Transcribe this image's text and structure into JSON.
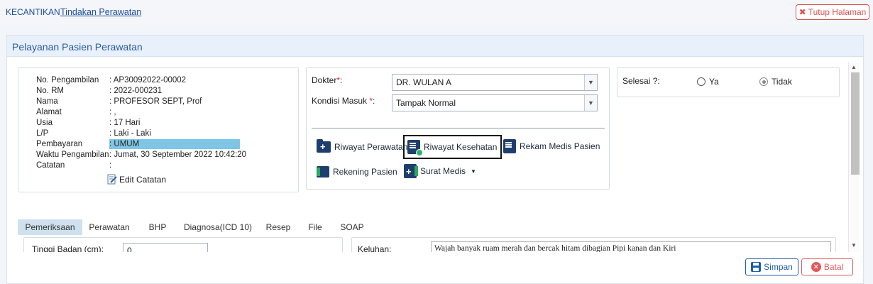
{
  "breadcrumb": {
    "root": "KECANTIKAN",
    "current": "Tindakan Perawatan"
  },
  "close_button": {
    "icon": "close-icon",
    "label": "Tutup Halaman"
  },
  "panel": {
    "title": "Pelayanan Pasien Perawatan"
  },
  "patient": {
    "rows": [
      {
        "label": "No. Pengambilan",
        "value": ": AP30092022-00002"
      },
      {
        "label": "No. RM",
        "value": ": 2022-000231"
      },
      {
        "label": "Nama",
        "value": ": PROFESOR SEPT, Prof"
      },
      {
        "label": "Alamat",
        "value": ": ,"
      },
      {
        "label": "Usia",
        "value": ": 17 Hari"
      },
      {
        "label": "L/P",
        "value": ": Laki - Laki"
      },
      {
        "label": "Pembayaran",
        "value": ": UMUM"
      },
      {
        "label": "Waktu Pengambilan",
        "value": ": Jumat, 30 September 2022 10:42:20"
      },
      {
        "label": "Catatan",
        "value": ":"
      }
    ],
    "edit_note_label": "Edit Catatan"
  },
  "form": {
    "doctor_label": "Dokter",
    "doctor_value": "DR. WULAN A",
    "condition_label": "Kondisi Masuk ",
    "condition_value": "Tampak Normal",
    "required_mark": "*",
    "colon": ":"
  },
  "actions": {
    "riwayat_perawatan": "Riwayat Perawatan",
    "riwayat_kesehatan": "Riwayat Kesehatan",
    "rekam_medis": "Rekam Medis Pasien",
    "rekening_pasien": "Rekening Pasien",
    "surat_medis": "Surat Medis"
  },
  "finish": {
    "label": "Selesai ?:",
    "options": [
      "Ya",
      "Tidak"
    ],
    "selected": "Tidak"
  },
  "tabs": [
    "Pemeriksaan",
    "Perawatan",
    "BHP",
    "Diagnosa(ICD 10)",
    "Resep",
    "File",
    "SOAP"
  ],
  "active_tab": "Pemeriksaan",
  "exam": {
    "height_label": "Tinggi Badan (cm):",
    "height_value": "0",
    "complaint_label": "Keluhan:",
    "complaint_value": "Wajah banyak ruam merah dan bercak hitam dibagian Pipi kanan dan Kiri"
  },
  "footer": {
    "save": "Simpan",
    "cancel": "Batal"
  },
  "colors": {
    "accent": "#1c5fa8",
    "danger": "#d9534f",
    "active_tab": "#cfe1ee",
    "highlight": "#7fc6e6"
  }
}
